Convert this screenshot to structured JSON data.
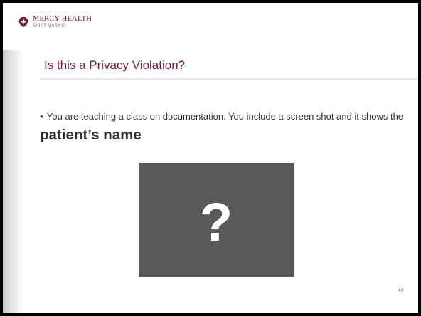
{
  "logo": {
    "name": "MERCY HEALTH",
    "subtitle": "SAINT MARY'S"
  },
  "slide": {
    "title": "Is this a Privacy Violation?",
    "bullet_symbol": "•",
    "body_text": "You are teaching a class on documentation.  You include a screen shot and it shows the ",
    "body_emphasis": "patient’s name",
    "image_placeholder": "?",
    "page_number": "40"
  },
  "colors": {
    "title": "#7a1a3a",
    "logo": "#5a1a2a",
    "placeholder_box": "#595959"
  }
}
